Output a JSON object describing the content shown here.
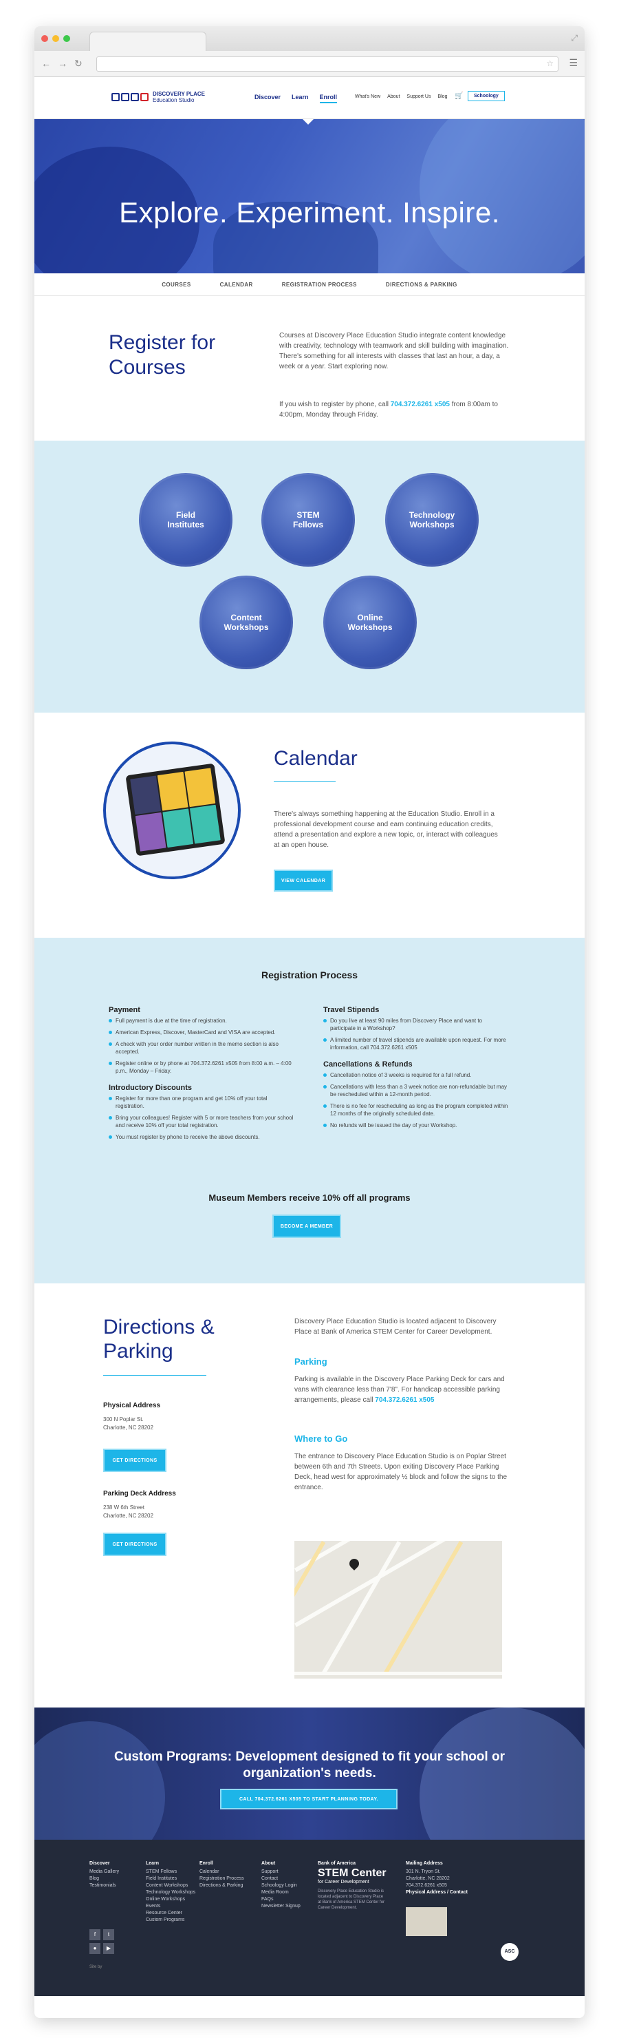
{
  "header": {
    "logo_line1": "DISCOVERY PLACE",
    "logo_line2": "Education Studio",
    "nav": [
      "Discover",
      "Learn",
      "Enroll"
    ],
    "util": [
      "What's New",
      "About",
      "Support Us",
      "Blog"
    ],
    "schoology": "Schoology"
  },
  "hero": {
    "title": "Explore. Experiment. Inspire."
  },
  "subnav": [
    "COURSES",
    "CALENDAR",
    "REGISTRATION PROCESS",
    "DIRECTIONS & PARKING"
  ],
  "register": {
    "title": "Register for Courses",
    "intro": "Courses at Discovery Place Education Studio integrate content knowledge with creativity, technology with teamwork and skill building with imagination. There's something for all interests with classes that last an hour, a day, a week or a year. Start exploring now.",
    "phone_pre": "If you wish to register by phone, call ",
    "phone": "704.372.6261 x505",
    "phone_post": " from 8:00am to 4:00pm, Monday through Friday."
  },
  "programs": [
    "Field Institutes",
    "STEM Fellows",
    "Technology Workshops",
    "Content Workshops",
    "Online Workshops"
  ],
  "calendar": {
    "title": "Calendar",
    "text": "There's always something happening at the Education Studio. Enroll in a professional development course and earn continuing education credits, attend a presentation and explore a new topic, or, interact with colleagues at an open house.",
    "button": "VIEW CALENDAR"
  },
  "process": {
    "title": "Registration Process",
    "payment_title": "Payment",
    "payment": [
      "Full payment is due at the time of registration.",
      "American Express, Discover, MasterCard and VISA are accepted.",
      "A check with your order number written in the memo section is also accepted.",
      "Register online or by phone at 704.372.6261 x505 from 8:00 a.m. – 4:00 p.m., Monday – Friday."
    ],
    "discounts_title": "Introductory Discounts",
    "discounts": [
      "Register for more than one program and get 10% off your total registration.",
      "Bring your colleagues! Register with 5 or more teachers from your school and receive 10% off your total registration.",
      "You must register by phone to receive the above discounts."
    ],
    "stipends_title": "Travel Stipends",
    "stipends": [
      "Do you live at least 90 miles from Discovery Place and want to participate in a Workshop?",
      "A limited number of travel stipends are available upon request. For more information, call 704.372.6261 x505"
    ],
    "cancel_title": "Cancellations & Refunds",
    "cancel": [
      "Cancellation notice of 3 weeks is required for a full refund.",
      "Cancellations with less than a 3 week notice are non-refundable but may be rescheduled within a 12-month period.",
      "There is no fee for rescheduling as long as the program completed within 12 months of the originally scheduled date.",
      "No refunds will be issued the day of your Workshop."
    ],
    "members": "Museum Members receive 10% off all programs",
    "button": "BECOME A MEMBER"
  },
  "directions": {
    "title": "Directions & Parking",
    "physical_label": "Physical Address",
    "physical_addr": [
      "300 N Poplar St.",
      "Charlotte, NC 28202"
    ],
    "deck_label": "Parking Deck Address",
    "deck_addr": [
      "238 W 6th Street",
      "Charlotte, NC 28202"
    ],
    "button": "GET DIRECTIONS",
    "intro": "Discovery Place Education Studio is located adjacent to Discovery Place at Bank of America STEM Center for Career Development.",
    "parking_title": "Parking",
    "parking_text": "Parking is available in the Discovery Place Parking Deck for cars and vans with clearance less than 7'8\". For handicap accessible parking arrangements, please call ",
    "parking_phone": "704.372.6261 x505",
    "where_title": "Where to Go",
    "where_text": "The entrance to Discovery Place Education Studio is on Poplar Street between 6th and 7th Streets. Upon exiting Discovery Place Parking Deck, head west for approximately ½ block and follow the signs to the entrance."
  },
  "custom": {
    "title": "Custom Programs: Development designed to fit your school or organization's needs.",
    "button": "CALL 704.372.6261 X505 TO START PLANNING TODAY."
  },
  "footer": {
    "discover": [
      "Discover",
      "Media Gallery",
      "Blog",
      "Testimonials"
    ],
    "learn": [
      "Learn",
      "STEM Fellows",
      "Field Institutes",
      "Content Workshops",
      "Technology Workshops",
      "Online Workshops",
      "Events",
      "Resource Center",
      "Custom Programs"
    ],
    "enroll": [
      "Enroll",
      "Calendar",
      "Registration Process",
      "Directions & Parking"
    ],
    "about": [
      "About",
      "Support",
      "Contact",
      "Schoology Login",
      "Media Room",
      "FAQs",
      "Newsletter Signup"
    ],
    "boa": "Bank of America",
    "stem": "STEM Center",
    "stem_sub": "for Career Development",
    "stem_desc": "Discovery Place Education Studio is located adjacent to Discovery Place at Bank of America STEM Center for Career Development.",
    "mailing": [
      "Mailing Address",
      "301 N. Tryon St.",
      "Charlotte, NC 28202",
      "704.372.6261 x505"
    ],
    "links": "Physical Address / Contact",
    "site_by": "Site by"
  },
  "colors": {
    "navy": "#1b2f8a",
    "cyan": "#1db5e8",
    "lightblue": "#d6ecf5",
    "footer": "#232a3a"
  }
}
